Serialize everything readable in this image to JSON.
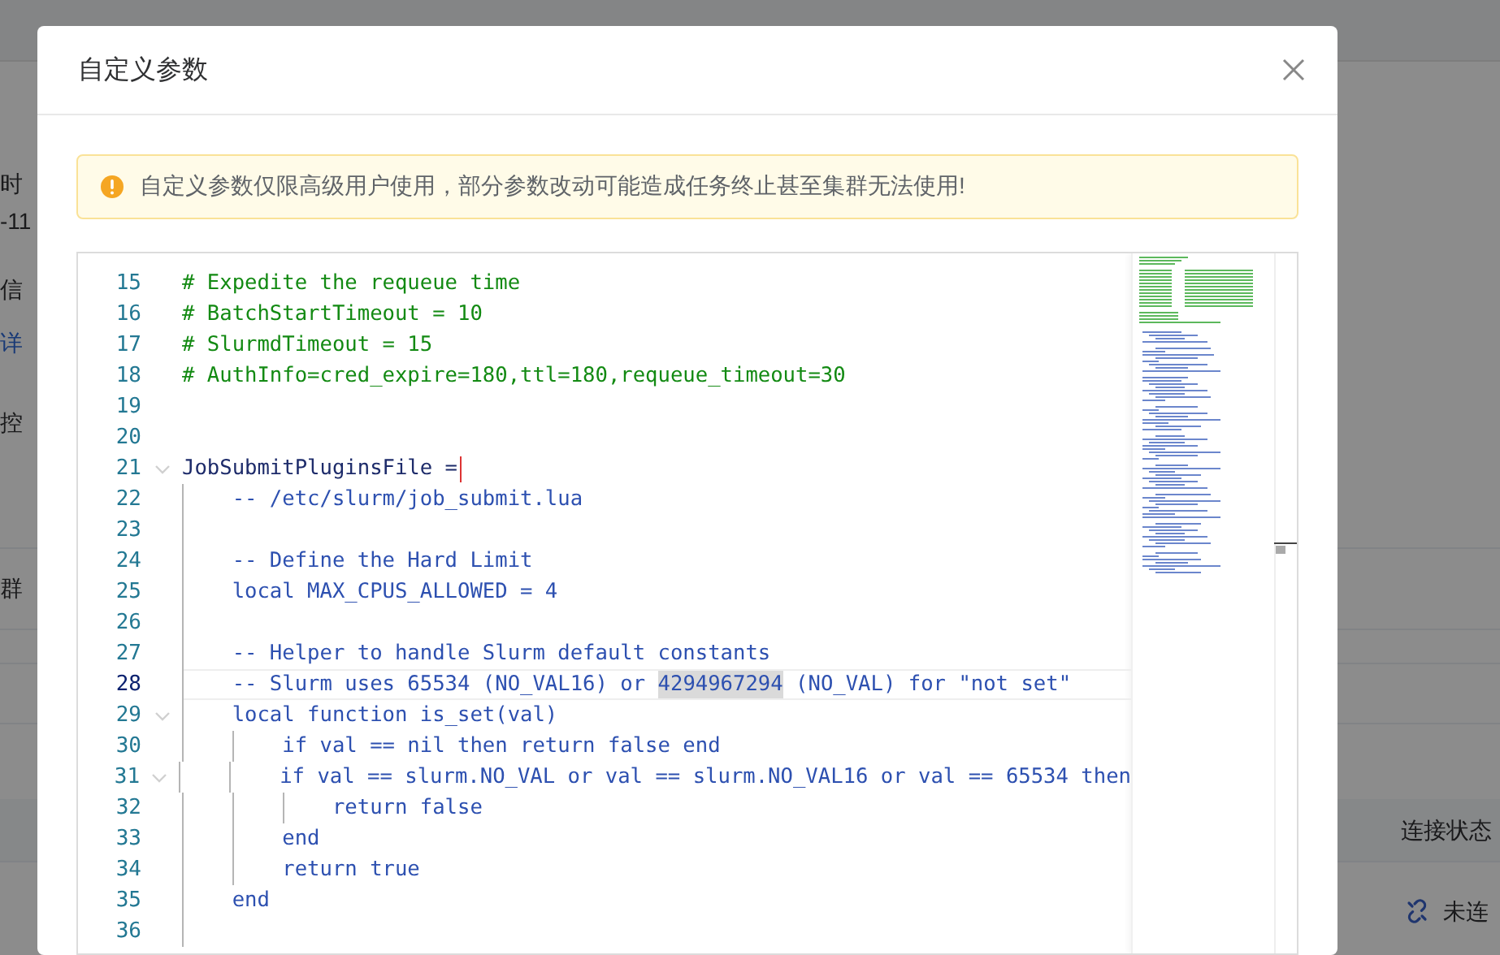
{
  "background_page": {
    "left_texts": [
      {
        "text": "时",
        "kind": "text"
      },
      {
        "text": "-11",
        "kind": "text"
      },
      {
        "text": "信",
        "kind": "text"
      },
      {
        "text": "详",
        "kind": "link"
      },
      {
        "text": "控",
        "kind": "text"
      },
      {
        "text": "群",
        "kind": "text"
      }
    ],
    "table": {
      "column_header": "连接状态",
      "status": "未连"
    }
  },
  "dialog": {
    "title": "自定义参数",
    "alert": {
      "text": "自定义参数仅限高级用户使用，部分参数改动可能造成任务终止甚至集群无法使用!"
    },
    "editor": {
      "lines": [
        {
          "number": "15",
          "kind": "comment",
          "current": false,
          "foldable": false,
          "segments": [
            {
              "text": "# Expedite the requeue time",
              "selected": false
            }
          ]
        },
        {
          "number": "16",
          "kind": "comment",
          "current": false,
          "foldable": false,
          "segments": [
            {
              "text": "# BatchStartTimeout = 10",
              "selected": false
            }
          ]
        },
        {
          "number": "17",
          "kind": "comment",
          "current": false,
          "foldable": false,
          "segments": [
            {
              "text": "# SlurmdTimeout = 15",
              "selected": false
            }
          ]
        },
        {
          "number": "18",
          "kind": "comment",
          "current": false,
          "foldable": false,
          "segments": [
            {
              "text": "# AuthInfo=cred_expire=180,ttl=180,requeue_timeout=30",
              "selected": false
            }
          ]
        },
        {
          "number": "19",
          "kind": "blank",
          "current": false,
          "foldable": false
        },
        {
          "number": "20",
          "kind": "blank",
          "current": false,
          "foldable": false
        },
        {
          "number": "21",
          "kind": "key",
          "current": false,
          "foldable": true,
          "cursor": true,
          "segments": [
            {
              "text": "JobSubmitPluginsFile =",
              "selected": false
            }
          ]
        },
        {
          "number": "22",
          "kind": "code",
          "current": false,
          "foldable": false,
          "segments": [
            {
              "text": "    -- /etc/slurm/job_submit.lua",
              "selected": false
            }
          ]
        },
        {
          "number": "23",
          "kind": "blank",
          "current": false,
          "foldable": false
        },
        {
          "number": "24",
          "kind": "code",
          "current": false,
          "foldable": false,
          "segments": [
            {
              "text": "    -- Define the Hard Limit",
              "selected": false
            }
          ]
        },
        {
          "number": "25",
          "kind": "code",
          "current": false,
          "foldable": false,
          "segments": [
            {
              "text": "    local MAX_CPUS_ALLOWED = 4",
              "selected": false
            }
          ]
        },
        {
          "number": "26",
          "kind": "blank",
          "current": false,
          "foldable": false
        },
        {
          "number": "27",
          "kind": "code",
          "current": false,
          "foldable": false,
          "segments": [
            {
              "text": "    -- Helper to handle Slurm default constants",
              "selected": false
            }
          ]
        },
        {
          "number": "28",
          "kind": "code",
          "current": true,
          "foldable": false,
          "segments": [
            {
              "text": "    -- Slurm uses 65534 (NO_VAL16) or ",
              "selected": false
            },
            {
              "text": "4294967294",
              "selected": true
            },
            {
              "text": " (NO_VAL) for \"not set\"",
              "selected": false
            }
          ]
        },
        {
          "number": "29",
          "kind": "code",
          "current": false,
          "foldable": true,
          "segments": [
            {
              "text": "    local function is_set(val)",
              "selected": false
            }
          ]
        },
        {
          "number": "30",
          "kind": "code",
          "current": false,
          "foldable": false,
          "segments": [
            {
              "text": "        if val == nil then return false end",
              "selected": false
            }
          ]
        },
        {
          "number": "31",
          "kind": "code",
          "current": false,
          "foldable": true,
          "segments": [
            {
              "text": "        if val == slurm.NO_VAL or val == slurm.NO_VAL16 or val == 65534 then",
              "selected": false
            }
          ]
        },
        {
          "number": "32",
          "kind": "code",
          "current": false,
          "foldable": false,
          "segments": [
            {
              "text": "            return false",
              "selected": false
            }
          ]
        },
        {
          "number": "33",
          "kind": "code",
          "current": false,
          "foldable": false,
          "segments": [
            {
              "text": "        end",
              "selected": false
            }
          ]
        },
        {
          "number": "34",
          "kind": "code",
          "current": false,
          "foldable": false,
          "segments": [
            {
              "text": "        return true",
              "selected": false
            }
          ]
        },
        {
          "number": "35",
          "kind": "code",
          "current": false,
          "foldable": false,
          "segments": [
            {
              "text": "    end",
              "selected": false
            }
          ]
        },
        {
          "number": "36",
          "kind": "blank",
          "current": false,
          "foldable": false
        }
      ]
    }
  }
}
